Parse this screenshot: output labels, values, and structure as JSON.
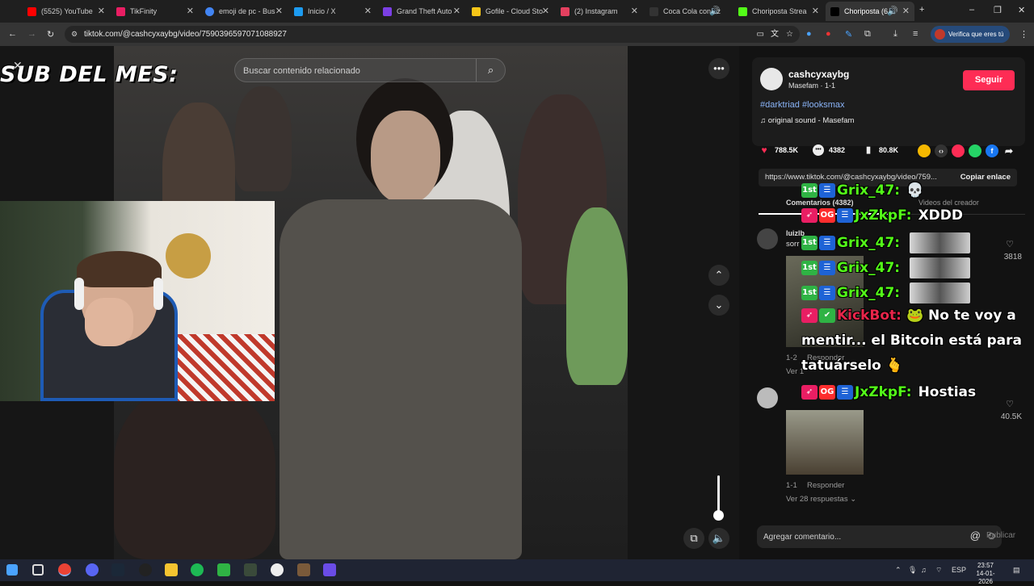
{
  "browser": {
    "tabs": [
      {
        "title": "(5525) YouTube",
        "color": "#ff0000"
      },
      {
        "title": "TikFinity",
        "color": "#e91e63"
      },
      {
        "title": "emoji de pc - Bus",
        "color": "#4285f4"
      },
      {
        "title": "Inicio / X",
        "color": "#1d9bf0"
      },
      {
        "title": "Grand Theft Auto",
        "color": "#7b3fe4"
      },
      {
        "title": "Gofile - Cloud Sto",
        "color": "#f5c518"
      },
      {
        "title": "(2) Instagram",
        "color": "#e4405f"
      },
      {
        "title": "Coca Cola con az",
        "color": "#222222"
      },
      {
        "title": "Choriposta Strea",
        "color": "#53fc18"
      },
      {
        "title": "Choriposta (6",
        "color": "#000000"
      }
    ],
    "url": "tiktok.com/@cashcyxaybg/video/7590396597071088927",
    "verify_label": "Verifica que eres tú"
  },
  "video": {
    "overlay_title": "SUB DEL MES:",
    "search_placeholder": "Buscar contenido relacionado"
  },
  "panel": {
    "username": "cashcyxaybg",
    "meta": "Masefam · 1-1",
    "follow_label": "Seguir",
    "hashtags": "#darktriad #looksmax",
    "sound": "original sound - Masefam",
    "likes": "788.5K",
    "comments_count": "4382",
    "saves": "80.8K",
    "link_url": "https://www.tiktok.com/@cashcyxaybg/video/759...",
    "copy_link_label": "Copiar enlace",
    "tab_comments": "Comentarios (4382)",
    "tab_creator": "Videos del creador",
    "comments": [
      {
        "name": "luizlb",
        "text": "sorr",
        "meta": "1-2",
        "reply": "Responder",
        "more": "Ver 1",
        "likes": "3818"
      },
      {
        "name": "",
        "text": "",
        "meta": "1-1",
        "reply": "Responder",
        "more": "Ver 28 respuestas ⌄",
        "likes": "40.5K"
      }
    ],
    "add_comment_placeholder": "Agregar comentario...",
    "publish_label": "Publicar"
  },
  "chat": [
    {
      "user": "Grix_47:",
      "msg": "💀"
    },
    {
      "user": "JxZkpF:",
      "msg": "XDDD"
    },
    {
      "user": "Grix_47:",
      "msg": ""
    },
    {
      "user": "Grix_47:",
      "msg": ""
    },
    {
      "user": "Grix_47:",
      "msg": ""
    },
    {
      "user": "KickBot:",
      "msg": "🐸 No te voy a"
    },
    {
      "user": "",
      "msg": "mentir... el Bitcoin está para"
    },
    {
      "user": "",
      "msg": "tatuárselo 🫰"
    },
    {
      "user": "JxZkpF:",
      "msg": "Hostias"
    }
  ],
  "taskbar": {
    "lang": "ESP",
    "time": "23:57",
    "date": "14-01-2026"
  }
}
